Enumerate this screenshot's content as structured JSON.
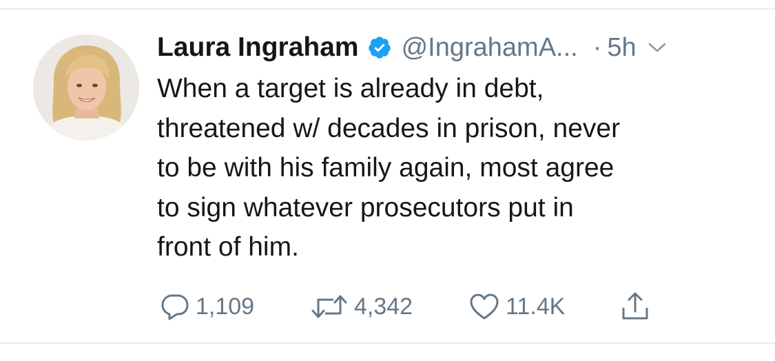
{
  "tweet": {
    "author": {
      "display_name": "Laura Ingraham",
      "handle": "@IngrahamA...",
      "verified": true
    },
    "separator": "·",
    "timestamp": "5h",
    "text_lines": [
      "When a target is already in debt,",
      "threatened w/ decades in prison, never",
      "to be with his family again, most agree",
      "to sign whatever prosecutors put in",
      "front of him."
    ],
    "stats": {
      "replies": "1,109",
      "retweets": "4,342",
      "likes": "11.4K"
    }
  },
  "icons": {
    "verified": "verified-badge-icon",
    "caret": "chevron-down-icon",
    "reply": "reply-icon",
    "retweet": "retweet-icon",
    "like": "heart-icon",
    "share": "share-icon"
  },
  "colors": {
    "verified_blue": "#1da1f2",
    "text_primary": "#14171a",
    "text_secondary": "#657786",
    "divider": "#e6ecf0"
  }
}
